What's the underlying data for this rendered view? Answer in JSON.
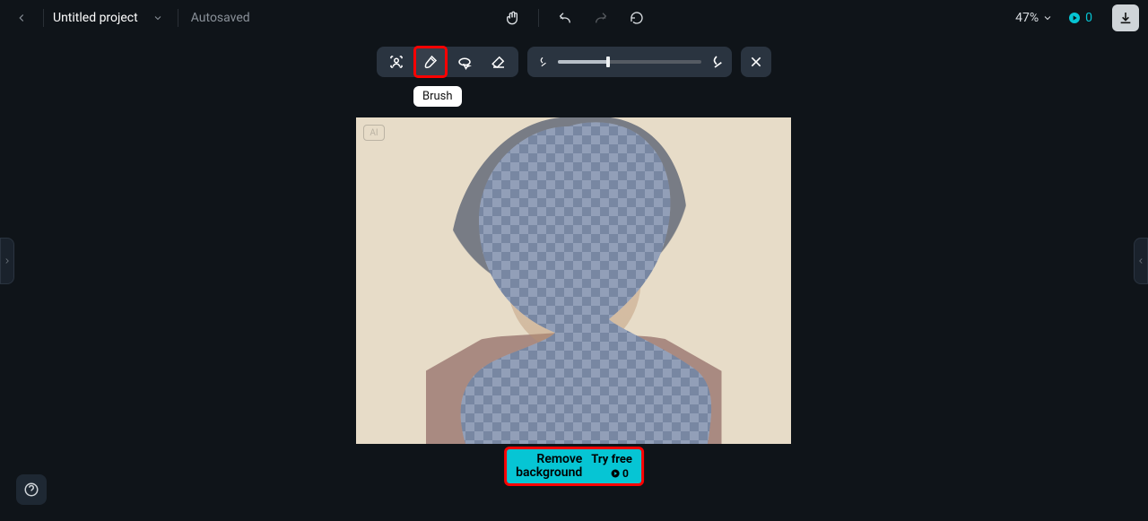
{
  "header": {
    "project_title": "Untitled project",
    "autosaved_label": "Autosaved",
    "zoom_label": "47%",
    "credits_count": "0"
  },
  "toolbar": {
    "brush_tooltip": "Brush",
    "slider_value_pct": 35
  },
  "canvas": {
    "ai_badge": "AI"
  },
  "remove_bg": {
    "line1": "Remove",
    "line2": "background",
    "try_label": "Try free",
    "credit_cost": "0"
  }
}
